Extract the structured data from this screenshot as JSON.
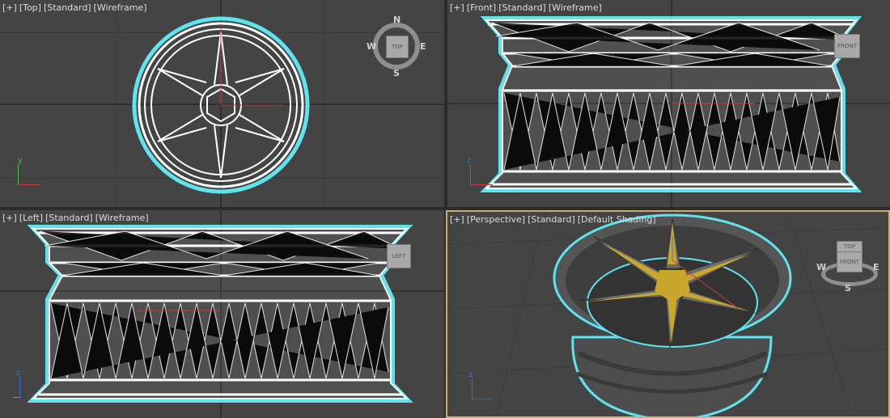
{
  "viewports": {
    "top": {
      "label_plus": "[+]",
      "label_view": "[Top]",
      "label_shading": "[Standard]",
      "label_mode": "[Wireframe]",
      "cube_face": "TOP"
    },
    "front": {
      "label_plus": "[+]",
      "label_view": "[Front]",
      "label_shading": "[Standard]",
      "label_mode": "[Wireframe]",
      "cube_face": "FRONT"
    },
    "left": {
      "label_plus": "[+]",
      "label_view": "[Left]",
      "label_shading": "[Standard]",
      "label_mode": "[Wireframe]",
      "cube_face": "LEFT"
    },
    "perspective": {
      "label_plus": "[+]",
      "label_view": "[Perspective]",
      "label_shading": "[Standard]",
      "label_mode": "[Default Shading]",
      "cube_top": "TOP",
      "cube_front": "FRONT"
    }
  },
  "compass": {
    "n": "N",
    "s": "S",
    "e": "E",
    "w": "W"
  },
  "axes": {
    "x": "x",
    "y": "y",
    "z": "z"
  },
  "colors": {
    "viewport_bg": "#444444",
    "wire": "#ffffff",
    "selection": "#5fe3ee",
    "active_border": "#c8b26a",
    "accent_gold": "#c9a72c"
  }
}
